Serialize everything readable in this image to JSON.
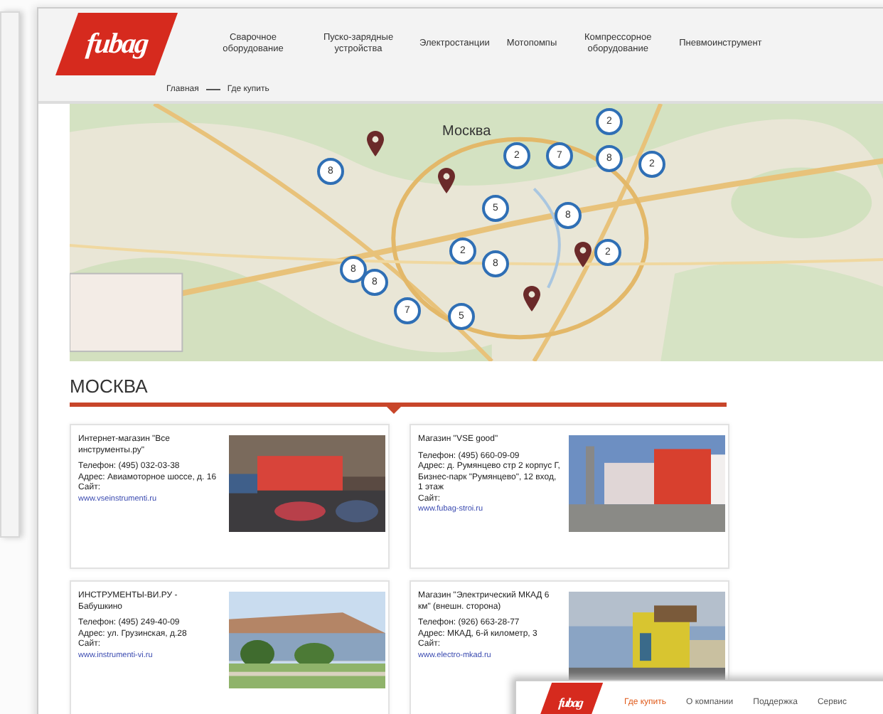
{
  "header": {
    "logo": "fubag",
    "nav": [
      {
        "label": "Сварочное оборудование"
      },
      {
        "label": "Пуско-зарядные устройства"
      },
      {
        "label": "Электростанции"
      },
      {
        "label": "Мотопомпы"
      },
      {
        "label": "Компрессорное оборудование"
      },
      {
        "label": "Пневмоинструмент"
      }
    ]
  },
  "breadcrumbs": [
    "Главная",
    "Где купить"
  ],
  "map": {
    "city_label": "Москва",
    "clusters": [
      "2",
      "8",
      "2",
      "7",
      "8",
      "2",
      "5",
      "8",
      "2",
      "2",
      "8",
      "8",
      "8",
      "7",
      "5"
    ]
  },
  "section_title": "МОСКВА",
  "stores": [
    {
      "name": "Интернет-магазин \"Все инструменты.ру\"",
      "phone": "Телефон: (495) 032-03-38",
      "address": "Адрес: Авиамоторное шоссе, д. 16",
      "site_label": "Сайт:",
      "site": "www.vseinstrumenti.ru"
    },
    {
      "name": "Магазин \"VSE good\"",
      "phone": "Телефон: (495) 660-09-09",
      "address": "Адрес: д. Румянцево стр 2 корпус Г, Бизнес-парк \"Румянцево\", 12 вход, 1 этаж",
      "site_label": "Сайт:",
      "site": "www.fubag-stroi.ru"
    },
    {
      "name": "ИНСТРУМЕНТЫ-ВИ.РУ - Бабушкино",
      "phone": "Телефон: (495) 249-40-09",
      "address": "Адрес: ул. Грузинская, д.28",
      "site_label": "Сайт:",
      "site": "www.instrumenti-vi.ru"
    },
    {
      "name": "Магазин \"Электрический МКАД 6 км\" (внешн. сторона)",
      "phone": "Телефон: (926) 663-28-77",
      "address": "Адрес: МКАД, 6-й километр, 3",
      "site_label": "Сайт:",
      "site": "www.electro-mkad.ru"
    }
  ],
  "second_screen": {
    "logo": "fubag",
    "nav": [
      {
        "label": "Где купить",
        "selected": true
      },
      {
        "label": "О компании",
        "selected": false
      },
      {
        "label": "Поддержка",
        "selected": false
      },
      {
        "label": "Сервис",
        "selected": false
      }
    ]
  }
}
